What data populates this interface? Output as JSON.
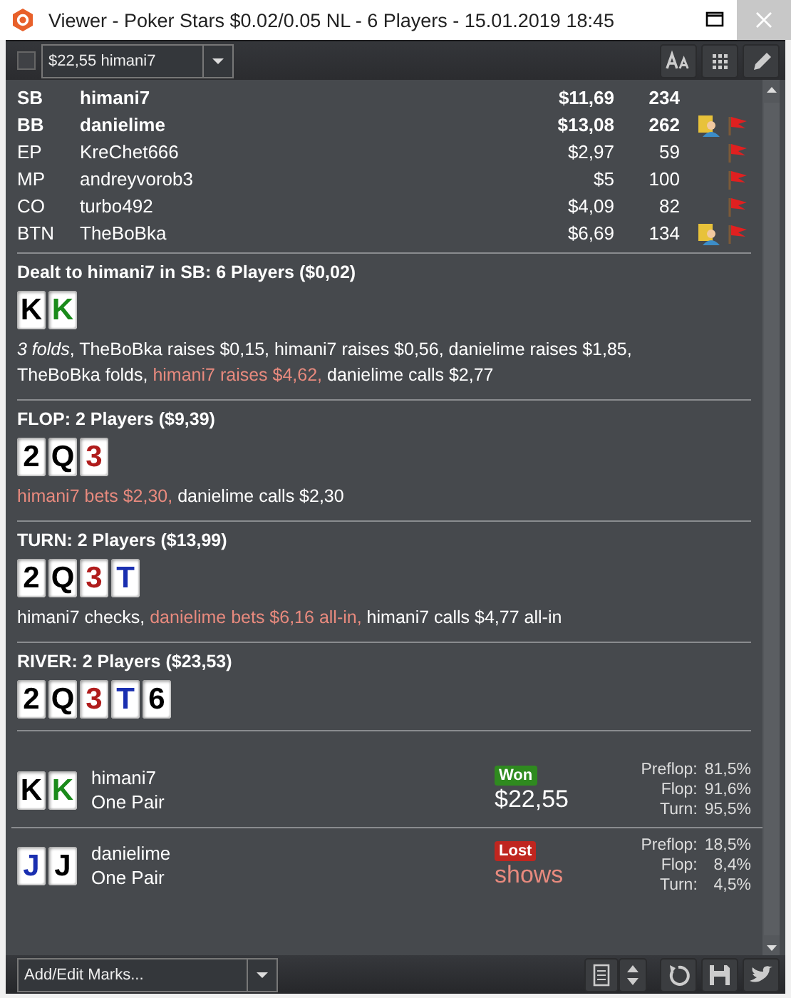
{
  "window": {
    "title": "Viewer - Poker Stars $0.02/0.05 NL - 6 Players - 15.01.2019 18:45"
  },
  "toolbar": {
    "checked": false,
    "hand_select": "$22,55 himani7"
  },
  "players": [
    {
      "position": "SB",
      "name": "himani7",
      "stack": "$11,69",
      "hands": "234",
      "in_hand": true,
      "has_note": false,
      "flagged": false
    },
    {
      "position": "BB",
      "name": "danielime",
      "stack": "$13,08",
      "hands": "262",
      "in_hand": true,
      "has_note": true,
      "flagged": true
    },
    {
      "position": "EP",
      "name": "KreChet666",
      "stack": "$2,97",
      "hands": "59",
      "in_hand": false,
      "has_note": false,
      "flagged": true
    },
    {
      "position": "MP",
      "name": "andreyvorob3",
      "stack": "$5",
      "hands": "100",
      "in_hand": false,
      "has_note": false,
      "flagged": true
    },
    {
      "position": "CO",
      "name": "turbo492",
      "stack": "$4,09",
      "hands": "82",
      "in_hand": false,
      "has_note": false,
      "flagged": true
    },
    {
      "position": "BTN",
      "name": "TheBoBka",
      "stack": "$6,69",
      "hands": "134",
      "in_hand": false,
      "has_note": true,
      "flagged": true
    }
  ],
  "streets": [
    {
      "heading": "Dealt to himani7 in SB: 6 Players ($0,02)",
      "cards": [
        {
          "rank": "K",
          "color": "#000000"
        },
        {
          "rank": "K",
          "color": "#1a8a1a"
        }
      ],
      "actions": [
        {
          "text": "*3 folds*,",
          "highlighted": false
        },
        {
          "text": "TheBoBka raises $0,15,",
          "highlighted": false
        },
        {
          "text": "himani7 raises $0,56,",
          "highlighted": false
        },
        {
          "text": "danielime raises $1,85,",
          "highlighted": false
        },
        {
          "text": "TheBoBka folds,",
          "highlighted": false
        },
        {
          "text": "himani7 raises $4,62,",
          "highlighted": true
        },
        {
          "text": "danielime calls $2,77",
          "highlighted": false
        }
      ]
    },
    {
      "heading": "FLOP: 2 Players ($9,39)",
      "cards": [
        {
          "rank": "2",
          "color": "#000000"
        },
        {
          "rank": "Q",
          "color": "#000000"
        },
        {
          "rank": "3",
          "color": "#b01c1c"
        }
      ],
      "actions": [
        {
          "text": "himani7 bets $2,30,",
          "highlighted": true
        },
        {
          "text": "danielime calls $2,30",
          "highlighted": false
        }
      ]
    },
    {
      "heading": "TURN: 2 Players ($13,99)",
      "cards": [
        {
          "rank": "2",
          "color": "#000000"
        },
        {
          "rank": "Q",
          "color": "#000000"
        },
        {
          "rank": "3",
          "color": "#b01c1c"
        },
        {
          "rank": "T",
          "color": "#1a2fb0"
        }
      ],
      "actions": [
        {
          "text": "himani7 checks,",
          "highlighted": false
        },
        {
          "text": "danielime bets $6,16 all-in,",
          "highlighted": true
        },
        {
          "text": "himani7 calls $4,77 all-in",
          "highlighted": false
        }
      ]
    },
    {
      "heading": "RIVER: 2 Players ($23,53)",
      "cards": [
        {
          "rank": "2",
          "color": "#000000"
        },
        {
          "rank": "Q",
          "color": "#000000"
        },
        {
          "rank": "3",
          "color": "#b01c1c"
        },
        {
          "rank": "T",
          "color": "#1a2fb0"
        },
        {
          "rank": "6",
          "color": "#000000"
        }
      ]
    }
  ],
  "results": [
    {
      "cards": [
        {
          "rank": "K",
          "color": "#000000"
        },
        {
          "rank": "K",
          "color": "#1a8a1a"
        }
      ],
      "name": "himani7",
      "hand": "One Pair",
      "color": "#2f8a1f",
      "badge": "Won",
      "amount": "$22,55",
      "amount_highlighted": false,
      "equity": [
        {
          "label": "Preflop:",
          "value": "81,5%"
        },
        {
          "label": "Flop:",
          "value": "91,6%"
        },
        {
          "label": "Turn:",
          "value": "95,5%"
        }
      ]
    },
    {
      "cards": [
        {
          "rank": "J",
          "color": "#1a2fb0"
        },
        {
          "rank": "J",
          "color": "#000000"
        }
      ],
      "name": "danielime",
      "hand": "One Pair",
      "color": "#c0261f",
      "badge": "Lost",
      "amount": "shows",
      "amount_highlighted": true,
      "equity": [
        {
          "label": "Preflop:",
          "value": "18,5%"
        },
        {
          "label": "Flop:",
          "value": "8,4%"
        },
        {
          "label": "Turn:",
          "value": "4,5%"
        }
      ]
    }
  ],
  "bottom": {
    "marks_select": "Add/Edit Marks..."
  }
}
